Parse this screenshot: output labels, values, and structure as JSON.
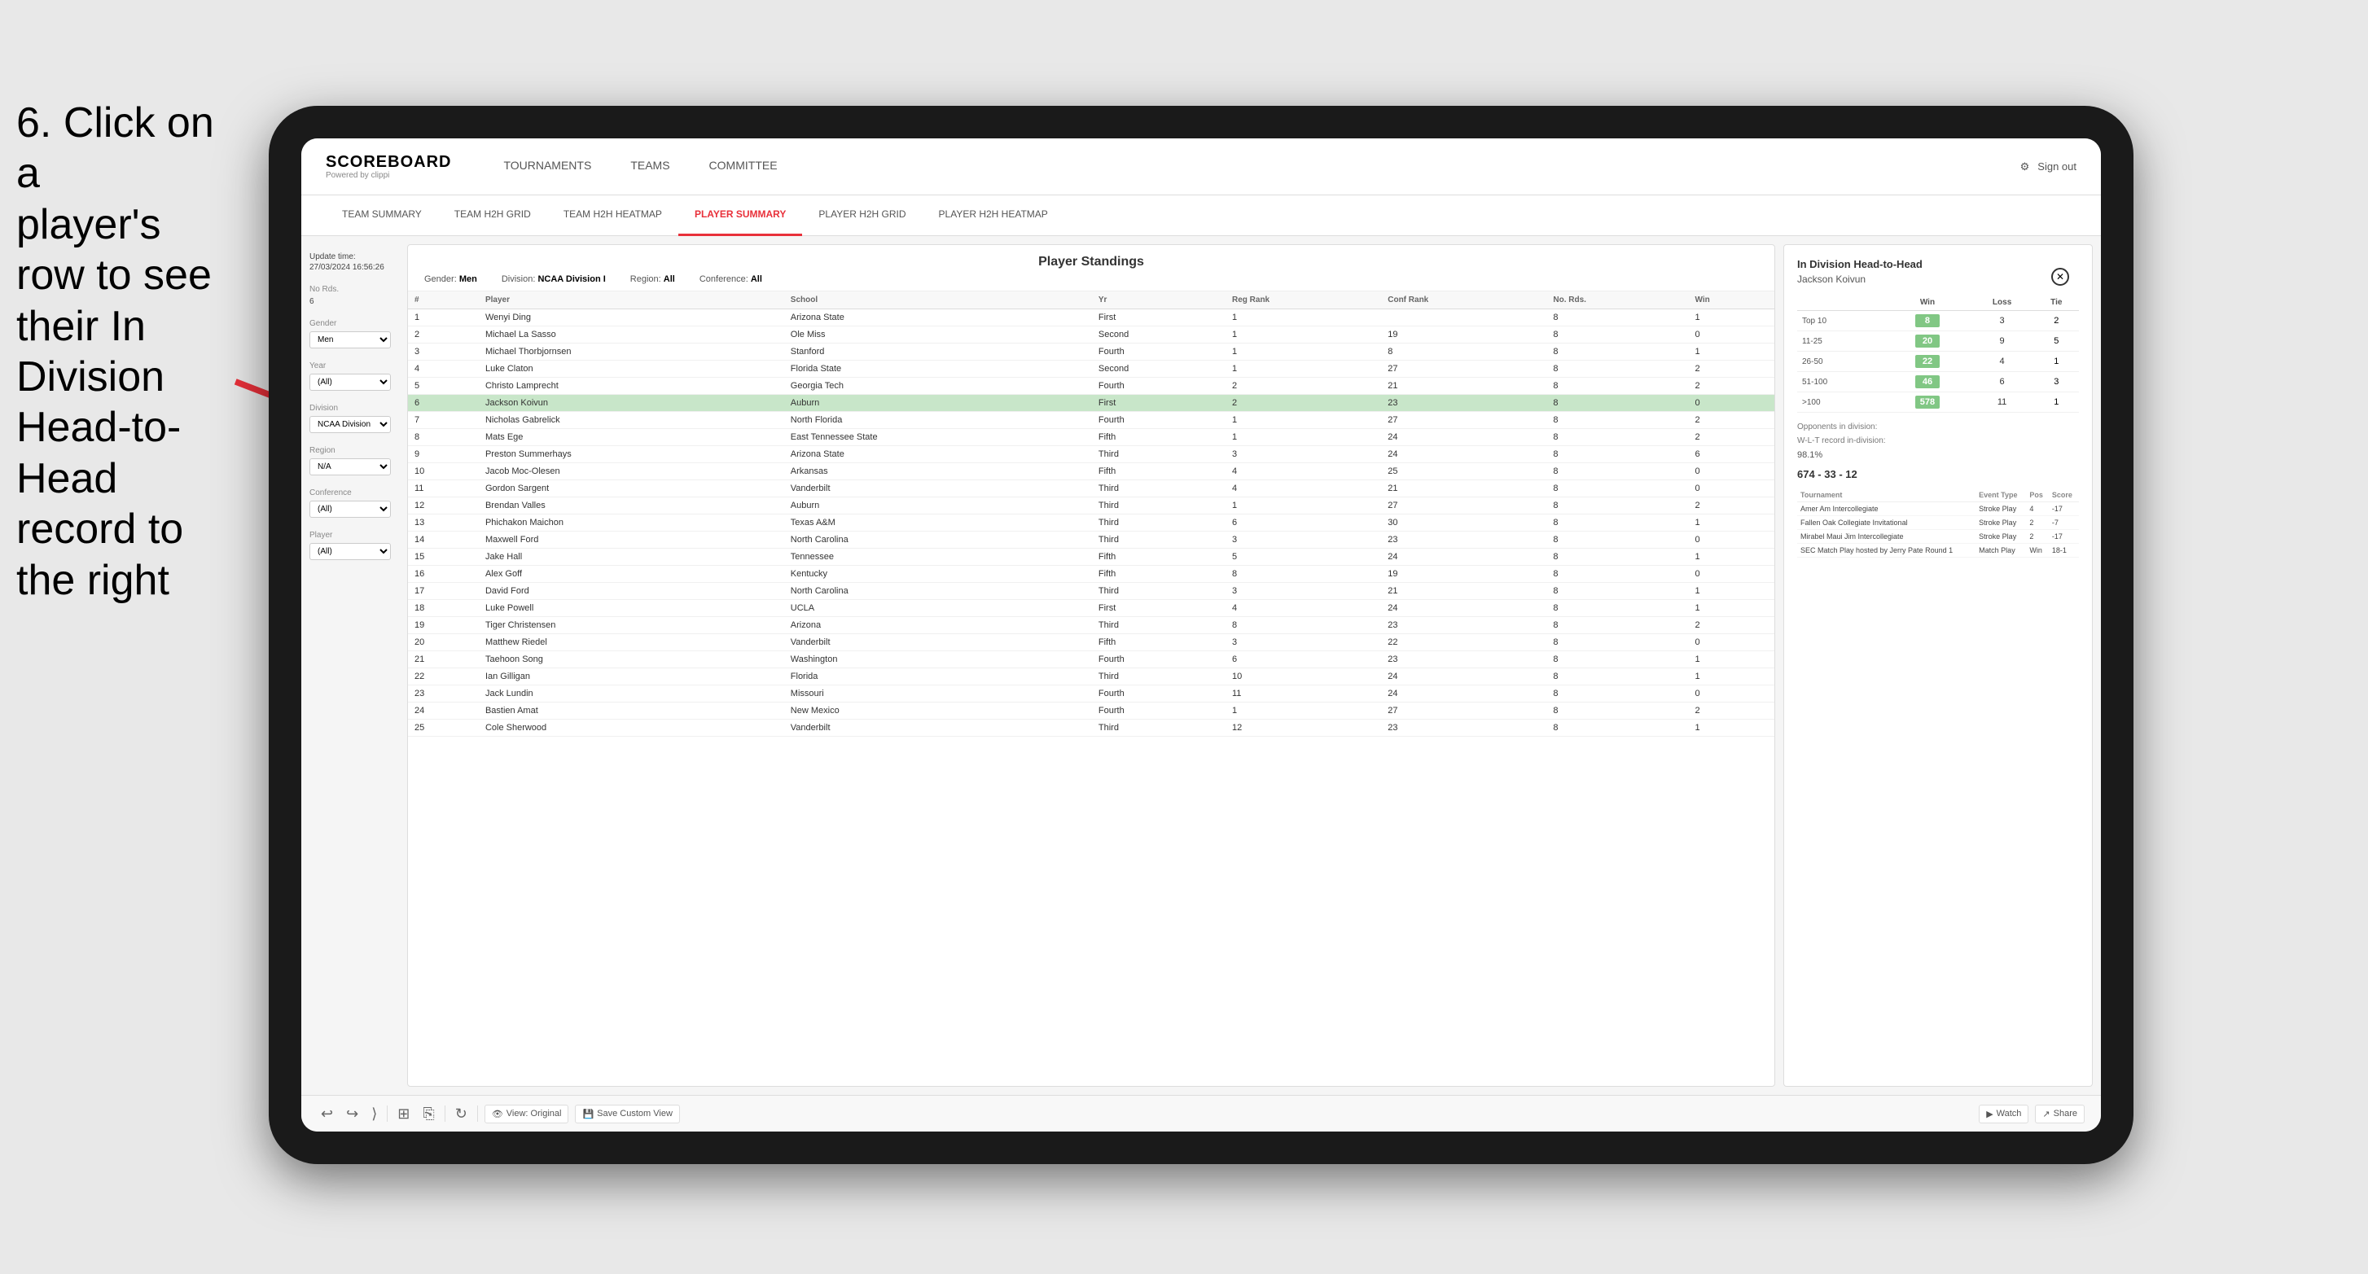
{
  "instruction": {
    "line1": "6. Click on a",
    "line2": "player's row to see",
    "line3": "their In Division",
    "line4": "Head-to-Head",
    "line5": "record to the right"
  },
  "nav": {
    "logo": "SCOREBOARD",
    "logo_sub": "Powered by clippi",
    "items": [
      "TOURNAMENTS",
      "TEAMS",
      "COMMITTEE"
    ],
    "sign_out": "Sign out"
  },
  "sub_nav": {
    "items": [
      "TEAM SUMMARY",
      "TEAM H2H GRID",
      "TEAM H2H HEATMAP",
      "PLAYER SUMMARY",
      "PLAYER H2H GRID",
      "PLAYER H2H HEATMAP"
    ],
    "active": "PLAYER SUMMARY"
  },
  "sidebar": {
    "update_label": "Update time:",
    "update_time": "27/03/2024 16:56:26",
    "no_rds_label": "No Rds.",
    "no_rds_val": "6",
    "gender_label": "Gender",
    "gender_val": "Men",
    "year_label": "Year",
    "year_val": "(All)",
    "division_label": "Division",
    "division_val": "NCAA Division I",
    "region_label": "Region",
    "region_val": "N/A",
    "conference_label": "Conference",
    "conference_val": "(All)",
    "player_label": "Player",
    "player_val": "(All)"
  },
  "standings": {
    "title": "Player Standings",
    "gender_label": "Gender:",
    "gender_val": "Men",
    "division_label": "Division:",
    "division_val": "NCAA Division I",
    "region_label": "Region:",
    "region_val": "All",
    "conference_label": "Conference:",
    "conference_val": "All",
    "columns": [
      "#",
      "Player",
      "School",
      "Yr",
      "Reg Rank",
      "Conf Rank",
      "No. Rds.",
      "Win"
    ],
    "rows": [
      {
        "num": 1,
        "player": "Wenyi Ding",
        "school": "Arizona State",
        "yr": "First",
        "reg": 1,
        "conf": "",
        "rds": 8,
        "win": 1
      },
      {
        "num": 2,
        "player": "Michael La Sasso",
        "school": "Ole Miss",
        "yr": "Second",
        "reg": 1,
        "conf": 19,
        "rds": 8,
        "win": 0
      },
      {
        "num": 3,
        "player": "Michael Thorbjornsen",
        "school": "Stanford",
        "yr": "Fourth",
        "reg": 1,
        "conf": 8,
        "rds": 8,
        "win": 1
      },
      {
        "num": 4,
        "player": "Luke Claton",
        "school": "Florida State",
        "yr": "Second",
        "reg": 1,
        "conf": 27,
        "rds": 8,
        "win": 2
      },
      {
        "num": 5,
        "player": "Christo Lamprecht",
        "school": "Georgia Tech",
        "yr": "Fourth",
        "reg": 2,
        "conf": 21,
        "rds": 8,
        "win": 2
      },
      {
        "num": 6,
        "player": "Jackson Koivun",
        "school": "Auburn",
        "yr": "First",
        "reg": 2,
        "conf": 23,
        "rds": 8,
        "win": 0,
        "highlighted": true
      },
      {
        "num": 7,
        "player": "Nicholas Gabrelick",
        "school": "North Florida",
        "yr": "Fourth",
        "reg": 1,
        "conf": 27,
        "rds": 8,
        "win": 2
      },
      {
        "num": 8,
        "player": "Mats Ege",
        "school": "East Tennessee State",
        "yr": "Fifth",
        "reg": 1,
        "conf": 24,
        "rds": 8,
        "win": 2
      },
      {
        "num": 9,
        "player": "Preston Summerhays",
        "school": "Arizona State",
        "yr": "Third",
        "reg": 3,
        "conf": 24,
        "rds": 8,
        "win": 6
      },
      {
        "num": 10,
        "player": "Jacob Moc-Olesen",
        "school": "Arkansas",
        "yr": "Fifth",
        "reg": 4,
        "conf": 25,
        "rds": 8,
        "win": 0
      },
      {
        "num": 11,
        "player": "Gordon Sargent",
        "school": "Vanderbilt",
        "yr": "Third",
        "reg": 4,
        "conf": 21,
        "rds": 8,
        "win": 0
      },
      {
        "num": 12,
        "player": "Brendan Valles",
        "school": "Auburn",
        "yr": "Third",
        "reg": 1,
        "conf": 27,
        "rds": 8,
        "win": 2
      },
      {
        "num": 13,
        "player": "Phichakon Maichon",
        "school": "Texas A&M",
        "yr": "Third",
        "reg": 6,
        "conf": 30,
        "rds": 8,
        "win": 1
      },
      {
        "num": 14,
        "player": "Maxwell Ford",
        "school": "North Carolina",
        "yr": "Third",
        "reg": 3,
        "conf": 23,
        "rds": 8,
        "win": 0
      },
      {
        "num": 15,
        "player": "Jake Hall",
        "school": "Tennessee",
        "yr": "Fifth",
        "reg": 5,
        "conf": 24,
        "rds": 8,
        "win": 1
      },
      {
        "num": 16,
        "player": "Alex Goff",
        "school": "Kentucky",
        "yr": "Fifth",
        "reg": 8,
        "conf": 19,
        "rds": 8,
        "win": 0
      },
      {
        "num": 17,
        "player": "David Ford",
        "school": "North Carolina",
        "yr": "Third",
        "reg": 3,
        "conf": 21,
        "rds": 8,
        "win": 1
      },
      {
        "num": 18,
        "player": "Luke Powell",
        "school": "UCLA",
        "yr": "First",
        "reg": 4,
        "conf": 24,
        "rds": 8,
        "win": 1
      },
      {
        "num": 19,
        "player": "Tiger Christensen",
        "school": "Arizona",
        "yr": "Third",
        "reg": 8,
        "conf": 23,
        "rds": 8,
        "win": 2
      },
      {
        "num": 20,
        "player": "Matthew Riedel",
        "school": "Vanderbilt",
        "yr": "Fifth",
        "reg": 3,
        "conf": 22,
        "rds": 8,
        "win": 0
      },
      {
        "num": 21,
        "player": "Taehoon Song",
        "school": "Washington",
        "yr": "Fourth",
        "reg": 6,
        "conf": 23,
        "rds": 8,
        "win": 1
      },
      {
        "num": 22,
        "player": "Ian Gilligan",
        "school": "Florida",
        "yr": "Third",
        "reg": 10,
        "conf": 24,
        "rds": 8,
        "win": 1
      },
      {
        "num": 23,
        "player": "Jack Lundin",
        "school": "Missouri",
        "yr": "Fourth",
        "reg": 11,
        "conf": 24,
        "rds": 8,
        "win": 0
      },
      {
        "num": 24,
        "player": "Bastien Amat",
        "school": "New Mexico",
        "yr": "Fourth",
        "reg": 1,
        "conf": 27,
        "rds": 8,
        "win": 2
      },
      {
        "num": 25,
        "player": "Cole Sherwood",
        "school": "Vanderbilt",
        "yr": "Third",
        "reg": 12,
        "conf": 23,
        "rds": 8,
        "win": 1
      }
    ]
  },
  "h2h": {
    "title": "In Division Head-to-Head",
    "player": "Jackson Koivun",
    "grid_cols": [
      "Win",
      "Loss",
      "Tie"
    ],
    "grid_rows": [
      {
        "range": "Top 10",
        "win": 8,
        "loss": 3,
        "tie": 2
      },
      {
        "range": "11-25",
        "win": 20,
        "loss": 9,
        "tie": 5
      },
      {
        "range": "26-50",
        "win": 22,
        "loss": 4,
        "tie": 1
      },
      {
        "range": "51-100",
        "win": 46,
        "loss": 6,
        "tie": 3
      },
      {
        "range": ">100",
        "win": 578,
        "loss": 11,
        "tie": 1
      }
    ],
    "opponents_label": "Opponents in division:",
    "wlt_label": "W-L-T record in-division:",
    "pct": "98.1%",
    "record": "674 - 33 - 12",
    "tournament_cols": [
      "Tournament",
      "Event Type",
      "Pos",
      "Score"
    ],
    "tournaments": [
      {
        "name": "Amer Am Intercollegiate",
        "type": "Stroke Play",
        "pos": 4,
        "score": "-17"
      },
      {
        "name": "Fallen Oak Collegiate Invitational",
        "type": "Stroke Play",
        "pos": 2,
        "score": "-7"
      },
      {
        "name": "Mirabel Maui Jim Intercollegiate",
        "type": "Stroke Play",
        "pos": 2,
        "score": "-17"
      },
      {
        "name": "SEC Match Play hosted by Jerry Pate Round 1",
        "type": "Match Play",
        "pos": "Win",
        "score": "18-1"
      }
    ]
  },
  "toolbar": {
    "undo": "↩",
    "redo": "↪",
    "forward": "⟩",
    "view_original": "View: Original",
    "save_custom": "Save Custom View",
    "watch": "Watch",
    "share": "Share"
  }
}
